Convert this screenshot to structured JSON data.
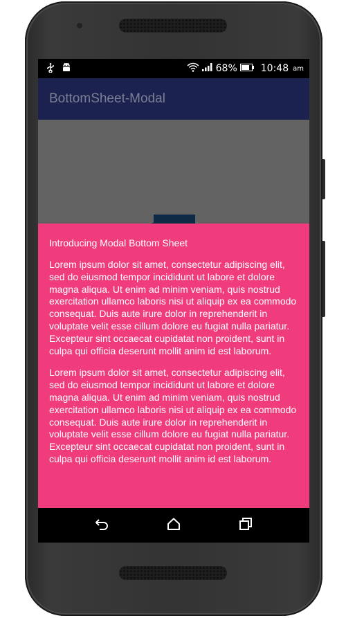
{
  "status_bar": {
    "battery_percent": "68%",
    "time": "10:48",
    "ampm": "am",
    "icons": [
      "usb-icon",
      "android-debug-icon",
      "wifi-icon",
      "signal-icon",
      "battery-icon"
    ]
  },
  "app_bar": {
    "title": "BottomSheet-Modal",
    "background": "#1b2250"
  },
  "bottom_sheet": {
    "background": "#f03c7d",
    "heading": "Introducing Modal Bottom Sheet",
    "paragraphs": [
      "Lorem ipsum dolor sit amet, consectetur adipiscing elit, sed do eiusmod tempor incididunt ut labore et dolore magna aliqua. Ut enim ad minim veniam, quis nostrud exercitation ullamco laboris nisi ut aliquip ex ea commodo consequat. Duis aute irure dolor in reprehenderit in voluptate velit esse cillum dolore eu fugiat nulla pariatur. Excepteur sint occaecat cupidatat non proident, sunt in culpa qui officia deserunt mollit anim id est laborum.",
      "Lorem ipsum dolor sit amet, consectetur adipiscing elit, sed do eiusmod tempor incididunt ut labore et dolore magna aliqua. Ut enim ad minim veniam, quis nostrud exercitation ullamco laboris nisi ut aliquip ex ea commodo consequat. Duis aute irure dolor in reprehenderit in voluptate velit esse cillum dolore eu fugiat nulla pariatur. Excepteur sint occaecat cupidatat non proident, sunt in culpa qui officia deserunt mollit anim id est laborum."
    ]
  },
  "nav_bar": {
    "buttons": [
      "back-icon",
      "home-icon",
      "recents-icon"
    ]
  }
}
